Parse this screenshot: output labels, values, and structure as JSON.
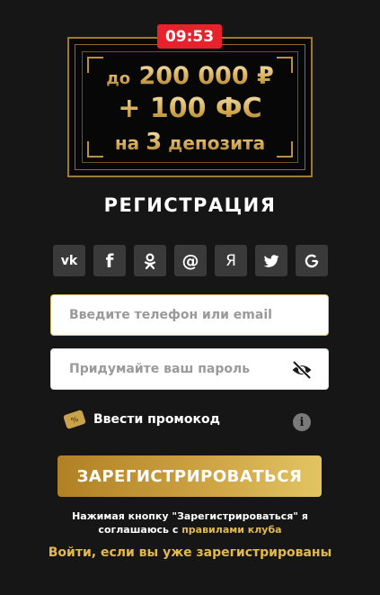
{
  "timer": "09:53",
  "banner": {
    "line1_prefix": "до",
    "line1_amount": "200 000 ₽",
    "line2": "+ 100 ФС",
    "line3_prefix": "на",
    "line3_number": "3",
    "line3_suffix": "депозита"
  },
  "title": "РЕГИСТРАЦИЯ",
  "socials": {
    "vk": "vk",
    "facebook": "f",
    "mail": "@",
    "yandex": "Я"
  },
  "form": {
    "phone_placeholder": "Введите телефон или email",
    "password_placeholder": "Придумайте ваш пароль",
    "promo_label": "Ввести промокод",
    "register_label": "ЗАРЕГИСТРИРОВАТЬСЯ"
  },
  "agreement": {
    "text": "Нажимая кнопку \"Зарегистрироваться\" я соглашаюсь с",
    "link": "правилами клуба"
  },
  "login_link": "Войти, если вы уже зарегистрированы",
  "colors": {
    "accent_gold": "#e3b94f",
    "timer_red": "#e8222c",
    "background": "#161616"
  }
}
